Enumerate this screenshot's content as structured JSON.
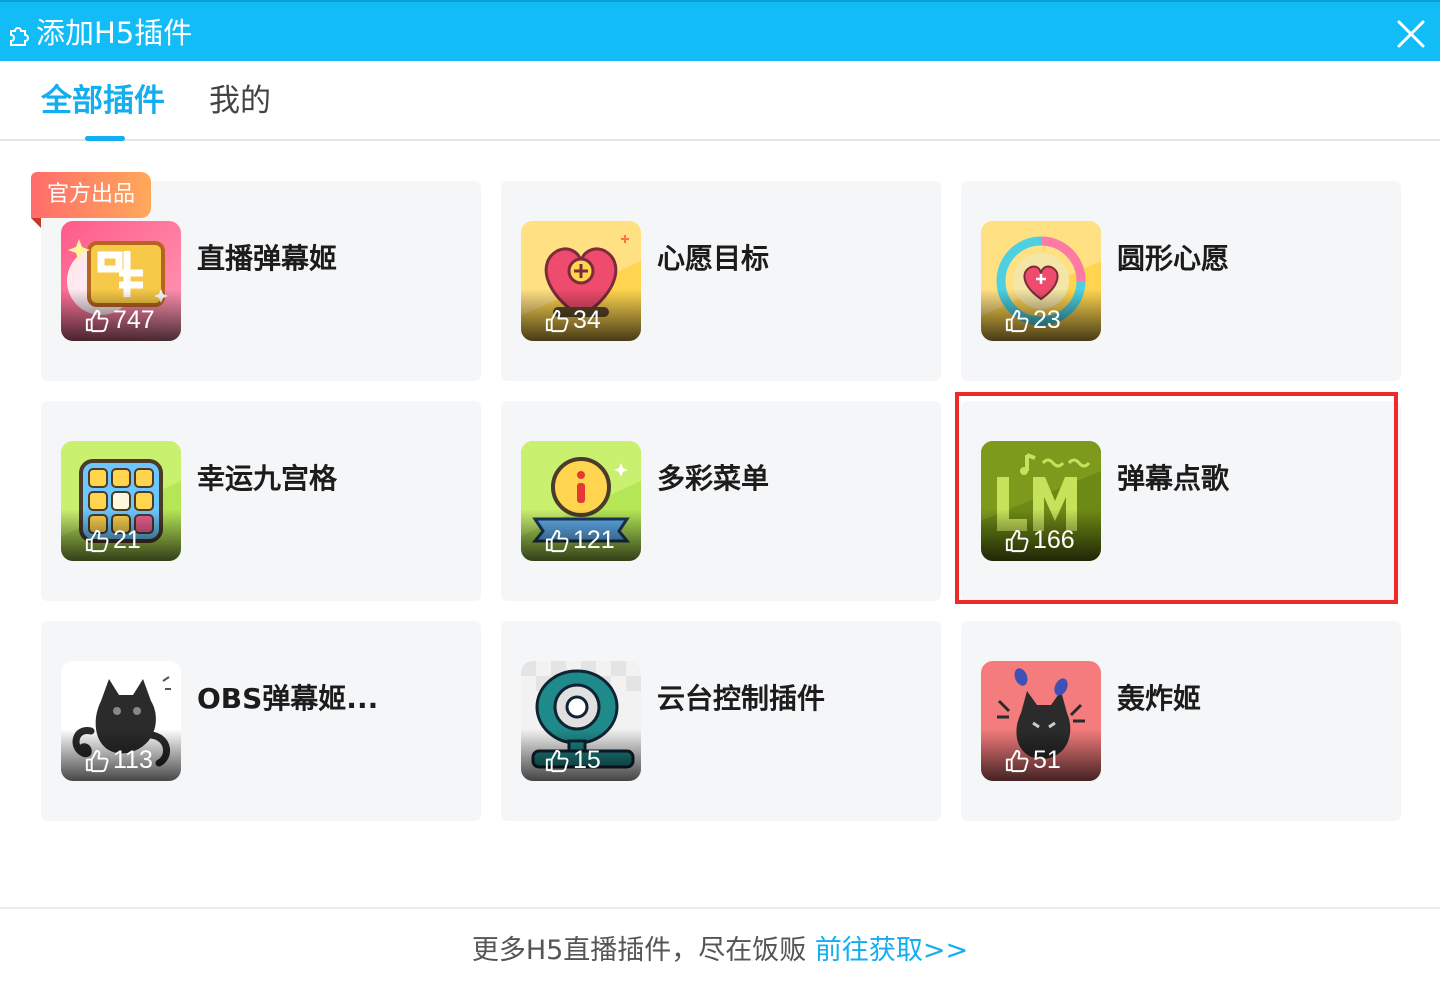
{
  "window": {
    "title": "添加H5插件"
  },
  "tabs": [
    {
      "label": "全部插件",
      "active": true
    },
    {
      "label": "我的",
      "active": false
    }
  ],
  "badge": {
    "label": "官方出品"
  },
  "plugins": [
    {
      "name": "直播弹幕姬",
      "likes": "747",
      "icon": "danmu-ji-icon"
    },
    {
      "name": "心愿目标",
      "likes": "34",
      "icon": "heart-goal-icon"
    },
    {
      "name": "圆形心愿",
      "likes": "23",
      "icon": "circle-heart-icon"
    },
    {
      "name": "幸运九宫格",
      "likes": "21",
      "icon": "lucky-grid-icon"
    },
    {
      "name": "多彩菜单",
      "likes": "121",
      "icon": "info-menu-icon"
    },
    {
      "name": "弹幕点歌",
      "likes": "166",
      "icon": "lm-music-icon"
    },
    {
      "name": "OBS弹幕姬...",
      "likes": "113",
      "icon": "black-cat-icon"
    },
    {
      "name": "云台控制插件",
      "likes": "15",
      "icon": "webcam-icon"
    },
    {
      "name": "轰炸姬",
      "likes": "51",
      "icon": "bomb-cat-icon"
    }
  ],
  "footer": {
    "text": "更多H5直播插件，尽在饭贩 ",
    "link": "前往获取>>"
  },
  "colors": {
    "accent": "#12aef0",
    "titlebar": "#12bcf7",
    "highlight": "#ee2b2b",
    "card_bg": "#f5f6f8"
  }
}
